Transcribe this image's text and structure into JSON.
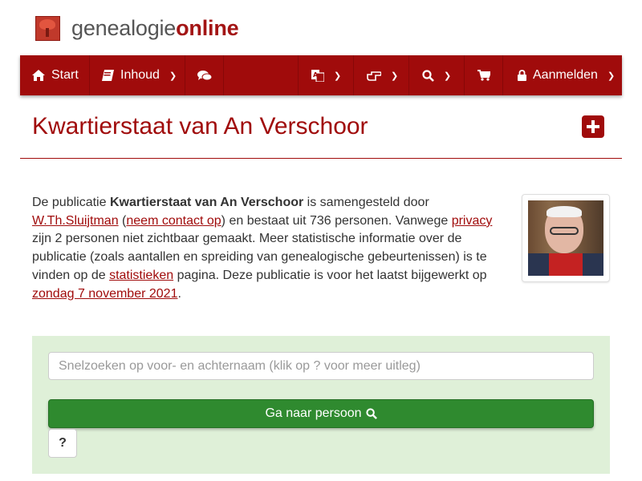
{
  "brand": {
    "prefix": "genealogie",
    "suffix": "online"
  },
  "nav": {
    "start": "Start",
    "inhoud": "Inhoud",
    "aanmelden": "Aanmelden"
  },
  "page": {
    "title": "Kwartierstaat van An Verschoor"
  },
  "intro": {
    "t1": "De publicatie ",
    "pub_name": "Kwartierstaat van An Verschoor",
    "t2": " is samengesteld door ",
    "author": "W.Th.Sluijtman",
    "t3": " (",
    "contact": "neem contact op",
    "t4": ") en bestaat uit 736 personen. Vanwege ",
    "privacy": "privacy",
    "t5": " zijn 2 personen niet zichtbaar gemaakt. Meer statistische informatie over de publicatie (zoals aantallen en spreiding van genealogische gebeurtenissen) is te vinden op de ",
    "stats": "statistieken",
    "t6": " pagina. Deze publicatie is voor het laatst bijgewerkt op ",
    "date": "zondag 7 november 2021",
    "t7": "."
  },
  "search": {
    "placeholder": "Snelzoeken op voor- en achternaam (klik op ? voor meer uitleg)",
    "go_label": "Ga naar persoon",
    "help_label": "?"
  },
  "icons": {
    "home": "home-icon",
    "book": "book-icon",
    "comments": "comments-icon",
    "translate": "translate-icon",
    "hand": "hand-point-icon",
    "search": "search-icon",
    "cart": "cart-icon",
    "lock": "lock-icon",
    "plus": "plus-square-icon"
  },
  "colors": {
    "brand_red": "#a00b0b",
    "panel_green": "#dff0d8",
    "button_green": "#2f8a2f"
  }
}
